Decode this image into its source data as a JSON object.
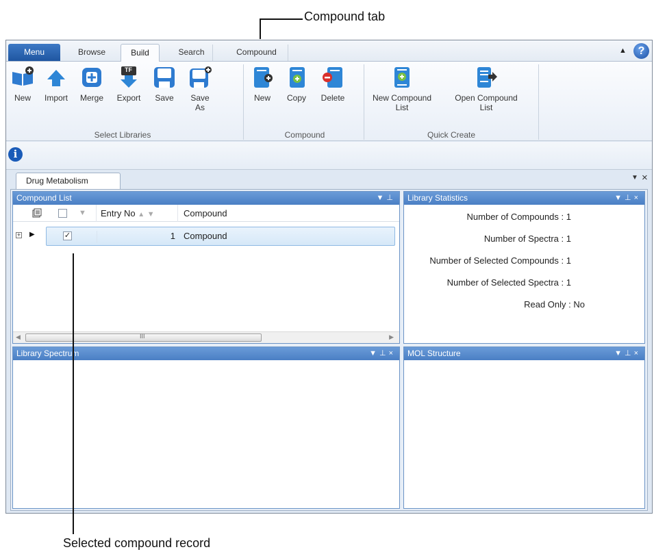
{
  "callouts": {
    "compound_tab": "Compound tab",
    "selected_record": "Selected compound record"
  },
  "tabs": {
    "menu": "Menu",
    "browse": "Browse",
    "build": "Build",
    "search": "Search",
    "compound": "Compound"
  },
  "ribbon": {
    "select_libraries": {
      "label": "Select Libraries",
      "new": "New",
      "import": "Import",
      "merge": "Merge",
      "export": "Export",
      "save": "Save",
      "save_as_line1": "Save",
      "save_as_line2": "As"
    },
    "compound": {
      "label": "Compound",
      "new": "New",
      "copy": "Copy",
      "delete": "Delete"
    },
    "quick_create": {
      "label": "Quick Create",
      "new_list_line1": "New Compound",
      "new_list_line2": "List",
      "open_list_line1": "Open Compound",
      "open_list_line2": "List"
    },
    "export_badge": "TF"
  },
  "document_tab": "Drug Metabolism",
  "panels": {
    "compound_list": {
      "title": "Compound List",
      "columns": {
        "entry_no": "Entry No",
        "compound": "Compound"
      },
      "rows": [
        {
          "checked": true,
          "entry_no": "1",
          "compound": "Compound"
        }
      ],
      "scroll_mark": "III"
    },
    "library_statistics": {
      "title": "Library Statistics",
      "items": [
        {
          "label": "Number of Compounds :",
          "value": "1"
        },
        {
          "label": "Number of Spectra :",
          "value": "1"
        },
        {
          "label": "Number of Selected Compounds :",
          "value": "1"
        },
        {
          "label": "Number of Selected Spectra :",
          "value": "1"
        },
        {
          "label": "Read Only :",
          "value": "No"
        }
      ]
    },
    "library_spectrum": {
      "title": "Library Spectrum"
    },
    "mol_structure": {
      "title": "MOL Structure"
    }
  },
  "colors": {
    "accent": "#4a7fc4",
    "menu_tab": "#1f56a1"
  }
}
